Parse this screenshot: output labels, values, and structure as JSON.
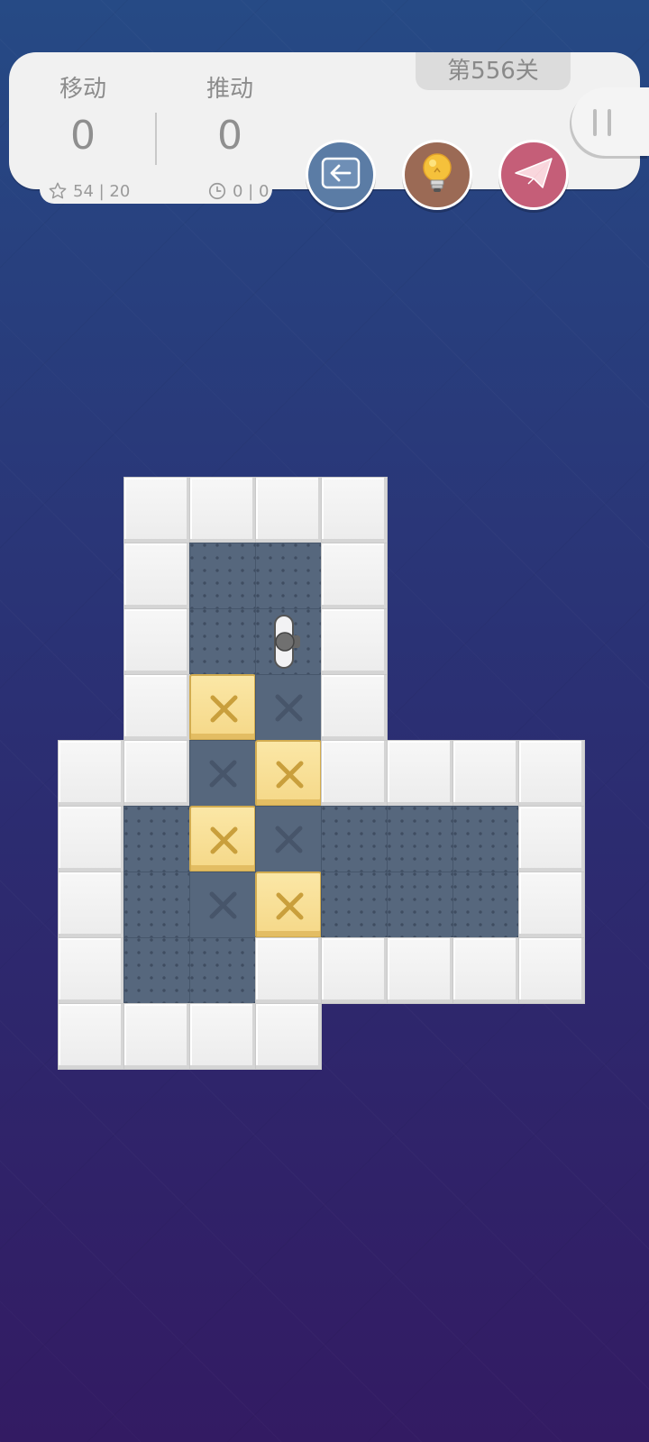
{
  "header": {
    "level_label": "第556关",
    "moves_label": "移动",
    "moves_value": "0",
    "pushes_label": "推动",
    "pushes_value": "0",
    "best_text": "54 | 20",
    "time_text": "0 | 0"
  },
  "buttons": {
    "undo_icon": "undo-arrow-icon",
    "hint_icon": "lightbulb-icon",
    "share_icon": "paper-plane-icon",
    "pause_icon": "pause-icon"
  },
  "colors": {
    "undo": "#5b7ca5",
    "hint": "#9b6a55",
    "share": "#c55e78",
    "floor": "#56677d",
    "box": "#f5d888"
  },
  "board": {
    "columns": 8,
    "rows": 9,
    "legend": {
      "#": "wall",
      ".": "floor",
      "x": "target",
      "B": "box-on-target",
      "P": "player",
      "-": "empty"
    },
    "grid": [
      "-####---",
      "-#..#---",
      "-#.P#---",
      "-#Bx#---",
      "##xB####",
      "#.Bx...#",
      "#.xB...#",
      "#..#####",
      "####----"
    ]
  }
}
